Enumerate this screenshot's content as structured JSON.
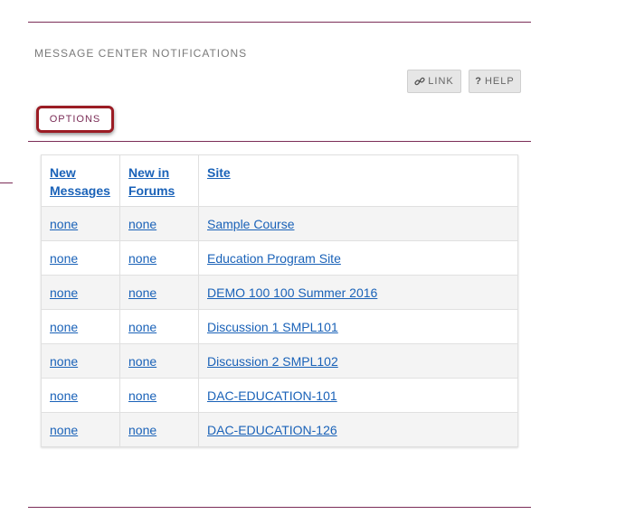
{
  "page": {
    "title": "MESSAGE CENTER NOTIFICATIONS"
  },
  "toolbar": {
    "link_label": "LINK",
    "help_label": "HELP",
    "help_prefix": "?"
  },
  "options_label": "OPTIONS",
  "table": {
    "headers": [
      {
        "line1": "New",
        "line2": "Messages"
      },
      {
        "line1": "New in",
        "line2": "Forums"
      },
      {
        "line1": "Site",
        "line2": ""
      }
    ],
    "rows": [
      {
        "messages": "none",
        "forums": "none",
        "site": "Sample Course"
      },
      {
        "messages": "none",
        "forums": "none",
        "site": "Education Program Site"
      },
      {
        "messages": "none",
        "forums": "none",
        "site": "DEMO 100 100 Summer 2016"
      },
      {
        "messages": "none",
        "forums": "none",
        "site": "Discussion 1 SMPL101"
      },
      {
        "messages": "none",
        "forums": "none",
        "site": "Discussion 2 SMPL102"
      },
      {
        "messages": "none",
        "forums": "none",
        "site": "DAC-EDUCATION-101"
      },
      {
        "messages": "none",
        "forums": "none",
        "site": "DAC-EDUCATION-126"
      }
    ]
  },
  "colors": {
    "accent": "#7b2d57",
    "options_border": "#9b1c24",
    "link": "#1a62b8"
  }
}
